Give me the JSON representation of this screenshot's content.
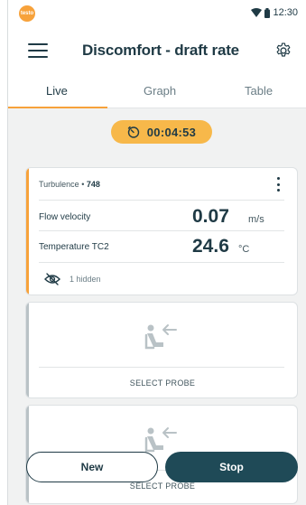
{
  "statusbar": {
    "logo_text": "testo",
    "time": "12:30",
    "icons": [
      "wifi-icon",
      "battery-icon"
    ]
  },
  "appbar": {
    "title": "Discomfort - draft rate",
    "menu_icon": "hamburger-menu-icon",
    "settings_icon": "gear-icon"
  },
  "tabs": [
    {
      "label": "Live",
      "active": true
    },
    {
      "label": "Graph",
      "active": false
    },
    {
      "label": "Table",
      "active": false
    }
  ],
  "timer": {
    "icon": "stopwatch-icon",
    "value": "00:04:53"
  },
  "probe_card": {
    "title_prefix": "Turbulence",
    "separator": " • ",
    "probe_id": "748",
    "measurements": [
      {
        "label": "Flow velocity",
        "value": "0.07",
        "unit": "m/s"
      },
      {
        "label": "Temperature TC2",
        "value": "24.6",
        "unit": "°C"
      }
    ],
    "hidden_label": "1 hidden",
    "hidden_icon": "eye-off-icon",
    "accent_color": "#f7a23b"
  },
  "empty_slots": [
    {
      "label": "SELECT PROBE",
      "icon": "probe-connect-icon"
    },
    {
      "label": "SELECT PROBE",
      "icon": "probe-connect-icon"
    }
  ],
  "actions": {
    "new_label": "New",
    "stop_label": "Stop"
  },
  "colors": {
    "accent": "#f7a23b",
    "primary": "#1f4a57",
    "timer_bg": "#f7b84a"
  }
}
